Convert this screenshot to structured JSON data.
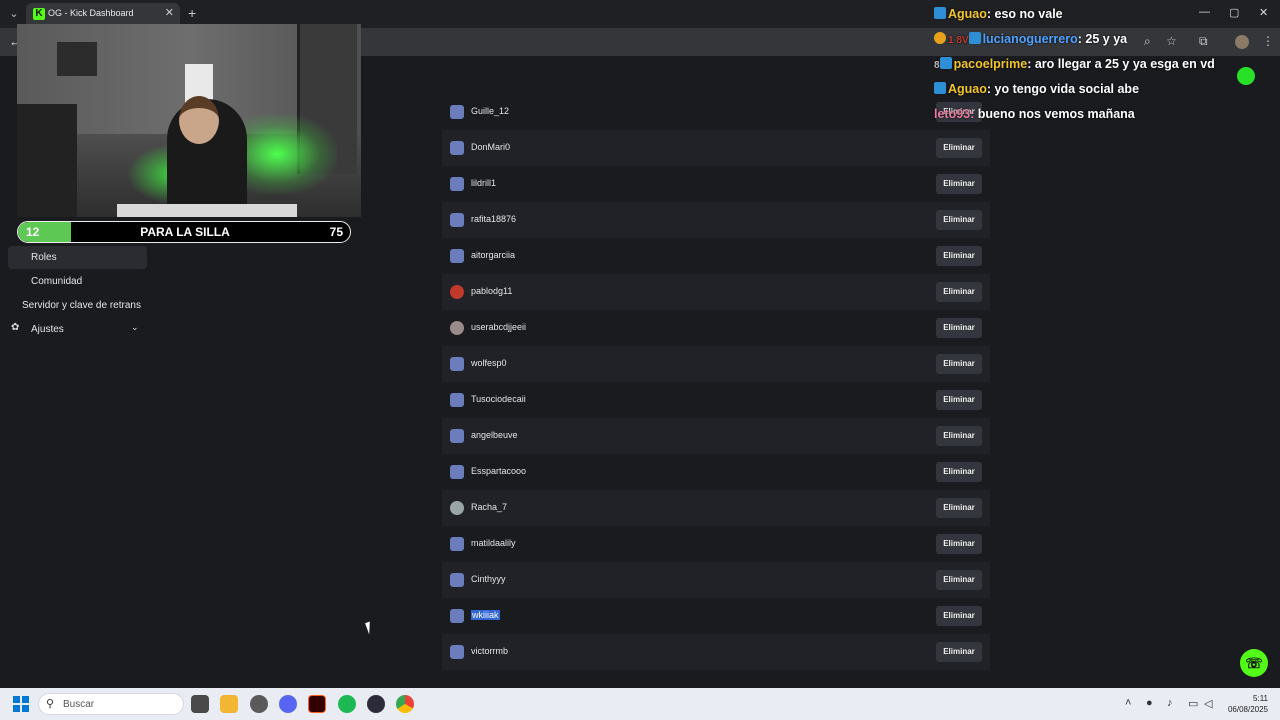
{
  "browser": {
    "tab_title": "OG - Kick Dashboard",
    "tab_favicon": "K",
    "tab_close": "✕",
    "new_tab": "+",
    "win_min": "—",
    "win_max": "▢",
    "win_close": "✕"
  },
  "sidebar": {
    "items": [
      {
        "label": "Roles",
        "active": true
      },
      {
        "label": "Comunidad"
      },
      {
        "label": "Servidor y clave de retrans"
      },
      {
        "label": "Ajustes",
        "icon": "gear-icon",
        "expandable": true
      }
    ]
  },
  "overlay": {
    "goal": {
      "current": "12",
      "label": "PARA LA SILLA",
      "target": "75",
      "progress_fraction": 0.16
    }
  },
  "list": {
    "button_label": "Eliminar",
    "rows": [
      {
        "name": "Guille_12"
      },
      {
        "name": "DonMari0"
      },
      {
        "name": "lildrill1"
      },
      {
        "name": "rafita18876"
      },
      {
        "name": "aitorgarciia"
      },
      {
        "name": "pablodg11"
      },
      {
        "name": "userabcdjjeeii"
      },
      {
        "name": "wolfesp0"
      },
      {
        "name": "Tusociodecaii"
      },
      {
        "name": "angelbeuve"
      },
      {
        "name": "Esspartacooo"
      },
      {
        "name": "Racha_7"
      },
      {
        "name": "matildaalily"
      },
      {
        "name": "Cinthyyy"
      },
      {
        "name": "wkiiiak",
        "selected": true
      },
      {
        "name": "victorrmb"
      }
    ]
  },
  "chat": {
    "messages": [
      {
        "user": "Aguao",
        "text": "eso no vale"
      },
      {
        "user": "lucianoguerrero",
        "prefix": "1 8V",
        "text": "25 y ya"
      },
      {
        "user": "pacoelprime",
        "prefix": "8",
        "text": "aro llegar a 25 y ya esga en vd"
      },
      {
        "user": "Aguao",
        "text": "yo tengo vida social abe"
      },
      {
        "user": "leto93",
        "text": "bueno nos vemos mañana"
      }
    ]
  },
  "taskbar": {
    "search_placeholder": "Buscar",
    "time": "5:11",
    "date": "06/08/2025"
  },
  "colors": {
    "accent": "#53fc18",
    "background": "#191b1f",
    "row_shade": "#202227",
    "button_bg": "#33363c"
  }
}
